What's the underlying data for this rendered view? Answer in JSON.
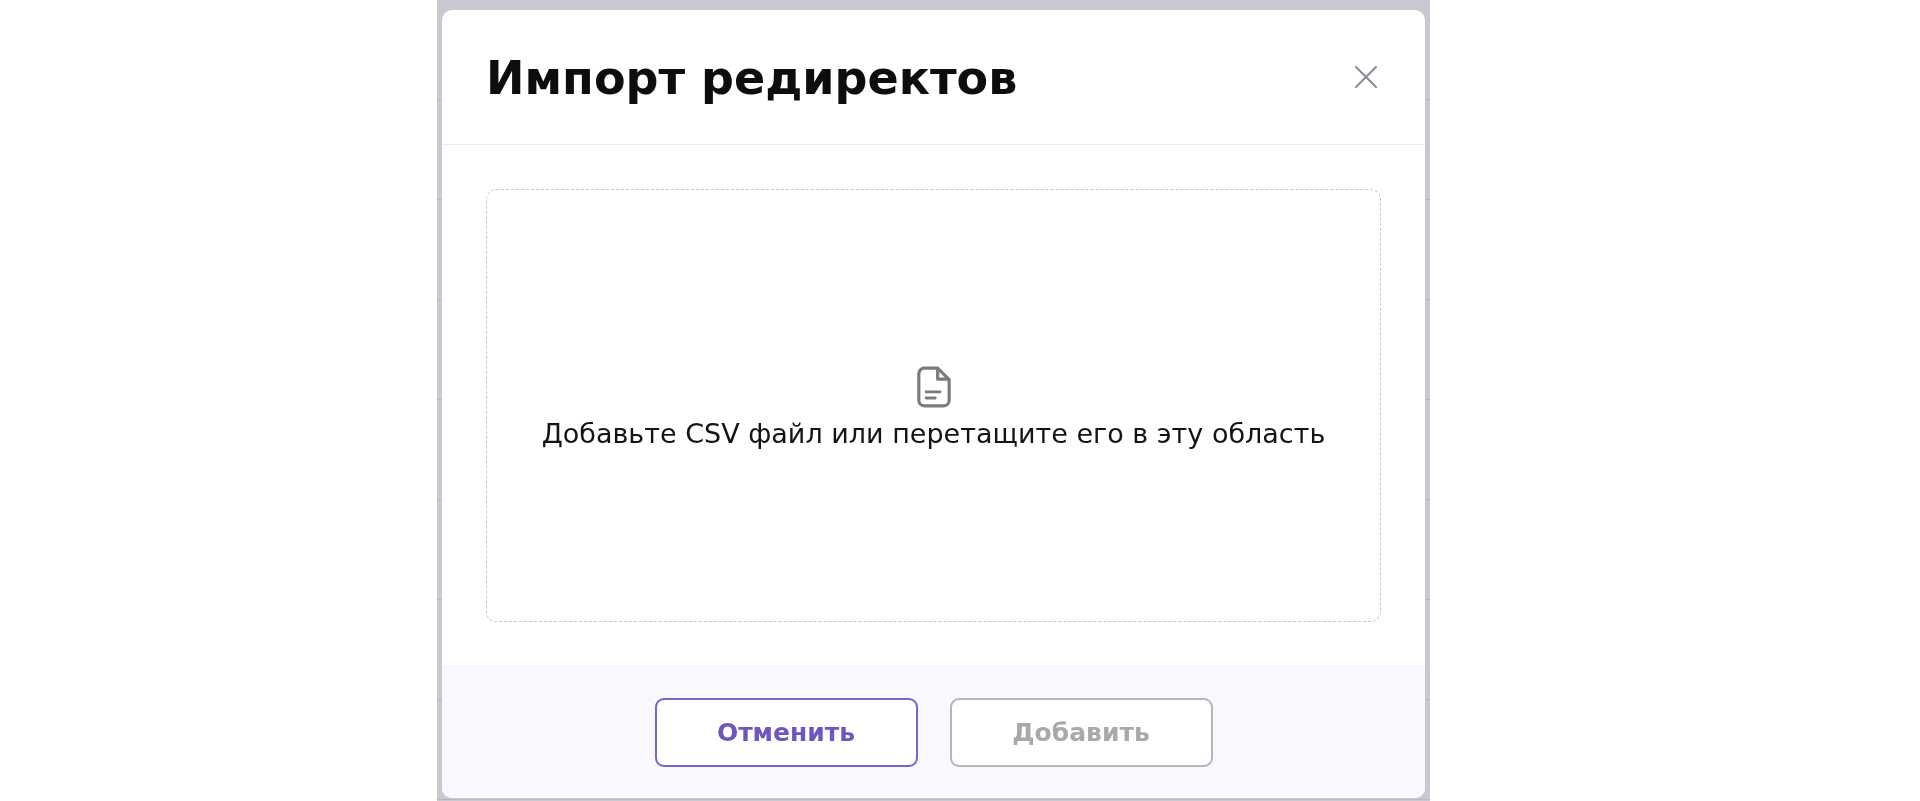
{
  "dialog": {
    "title": "Импорт редиректов",
    "dropzone": {
      "hint": "Добавьте CSV файл или перетащите его в эту область"
    },
    "buttons": [
      {
        "label": "Отменить",
        "disabled": false
      },
      {
        "label": "Добавить",
        "disabled": true
      }
    ]
  }
}
